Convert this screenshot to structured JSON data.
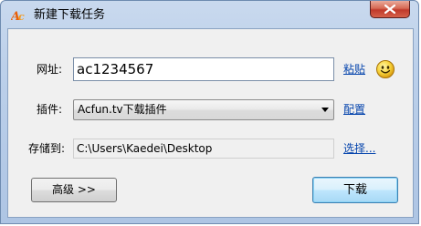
{
  "window": {
    "title": "新建下载任务",
    "app_icon": "acfun-logo-icon",
    "close_icon": "close-icon"
  },
  "form": {
    "url_label": "网址:",
    "url_value": "ac1234567",
    "paste_link": "粘贴",
    "smiley_icon": "smiley-icon",
    "plugin_label": "插件:",
    "plugin_selected": "Acfun.tv下载插件",
    "configure_link": "配置",
    "save_label": "存储到:",
    "save_path": "C:\\Users\\Kaedei\\Desktop",
    "browse_link": "选择..."
  },
  "buttons": {
    "advanced": "高级 >>",
    "download": "下载"
  },
  "colors": {
    "link": "#0645ad",
    "titlebar": "#bcd0ea",
    "close_button": "#c0392b",
    "default_button_border": "#3c7fb1"
  }
}
